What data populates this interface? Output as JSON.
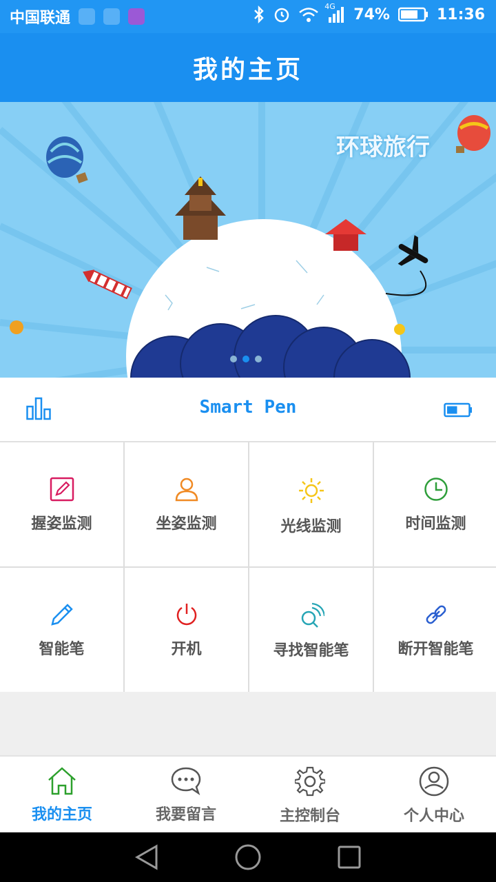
{
  "status_bar": {
    "carrier": "中国联通",
    "network": "4G",
    "battery_pct": "74%",
    "time": "11:36"
  },
  "header": {
    "title": "我的主页"
  },
  "banner": {
    "caption": "环球旅行",
    "slide_count": 3,
    "active_slide": 1
  },
  "device": {
    "name": "Smart Pen",
    "battery_level": 0.5
  },
  "features": [
    {
      "label": "握姿监测",
      "icon": "edit-square-icon",
      "color": "#d81b60"
    },
    {
      "label": "坐姿监测",
      "icon": "person-icon",
      "color": "#f08a24"
    },
    {
      "label": "光线监测",
      "icon": "sun-icon",
      "color": "#f5c518"
    },
    {
      "label": "时间监测",
      "icon": "clock-icon",
      "color": "#2e9e3a"
    },
    {
      "label": "智能笔",
      "icon": "pencil-icon",
      "color": "#1a8ff0"
    },
    {
      "label": "开机",
      "icon": "power-icon",
      "color": "#e02020"
    },
    {
      "label": "寻找智能笔",
      "icon": "search-signal-icon",
      "color": "#26a5b5"
    },
    {
      "label": "断开智能笔",
      "icon": "link-icon",
      "color": "#2a5fd0"
    }
  ],
  "tabs": [
    {
      "label": "我的主页",
      "icon": "home-icon",
      "active": true
    },
    {
      "label": "我要留言",
      "icon": "chat-bubble-icon",
      "active": false
    },
    {
      "label": "主控制台",
      "icon": "gear-icon",
      "active": false
    },
    {
      "label": "个人中心",
      "icon": "user-circle-icon",
      "active": false
    }
  ],
  "colors": {
    "primary": "#1a8ff0",
    "status_bar": "#2196f3"
  }
}
